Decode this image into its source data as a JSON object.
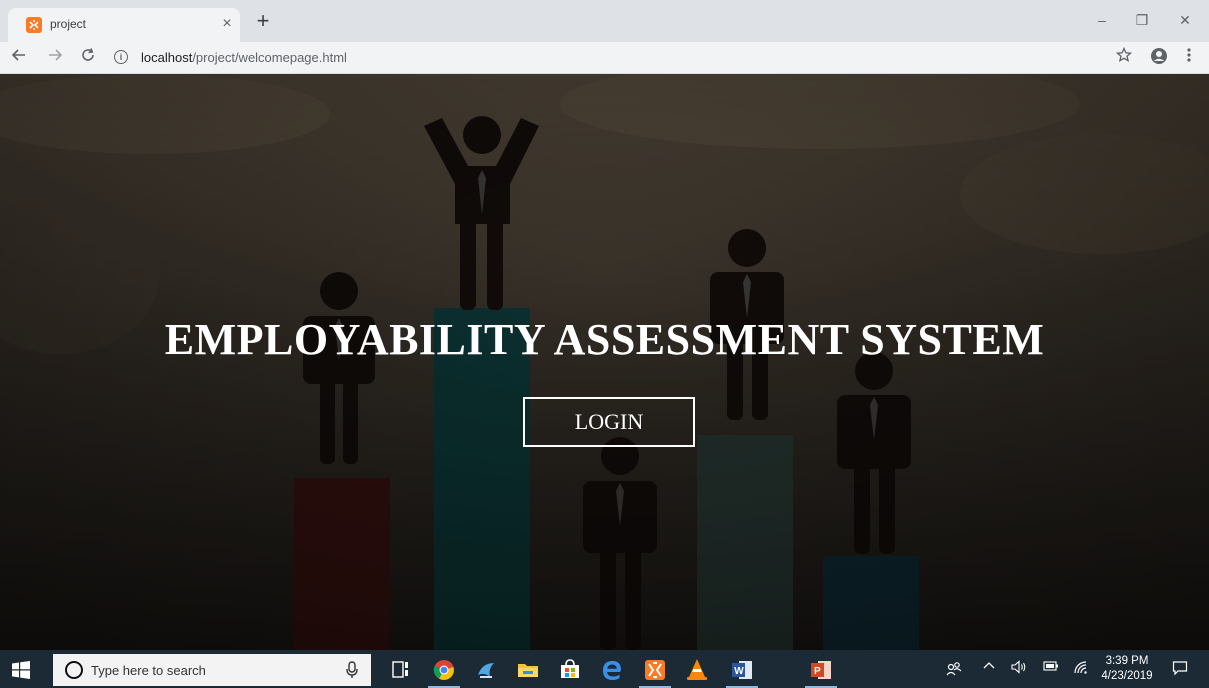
{
  "browser": {
    "tab_title": "project",
    "tab_close": "×",
    "new_tab": "+",
    "window_minimize": "–",
    "window_restore": "❐",
    "window_close": "✕",
    "url_host": "localhost",
    "url_path": "/project/welcomepage.html",
    "info_glyph": "i"
  },
  "page": {
    "title": "EMPLOYABILITY ASSESSMENT SYSTEM",
    "login_label": "LOGIN"
  },
  "taskbar": {
    "search_placeholder": "Type here to search",
    "time": "3:39 PM",
    "date": "4/23/2019",
    "pinned_apps": [
      "chrome-icon",
      "assistant-icon",
      "file-explorer-icon",
      "store-icon",
      "edge-icon",
      "xampp-icon",
      "vlc-icon",
      "word-icon",
      "powerpoint-icon"
    ]
  },
  "colors": {
    "tab_strip": "#dee1e6",
    "toolbar": "#f1f3f4",
    "taskbar": "#1b2a35",
    "hero_overlay": "#2f2a24",
    "bar_red": "#3c1410",
    "bar_teal": "#0d3a3a",
    "bar_muted": "#2a3a36",
    "bar_blue": "#10303a",
    "figure": "#120d0b",
    "xampp": "#fb7a24"
  }
}
